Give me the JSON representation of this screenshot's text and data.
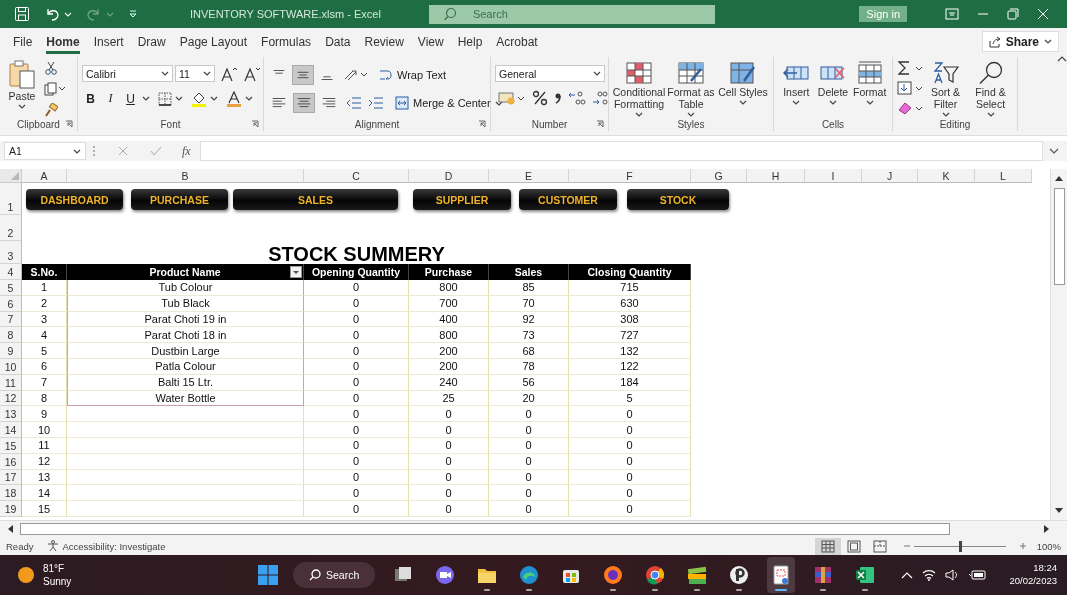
{
  "title_bar": {
    "title": "INVENTORY SOFTWARE.xlsm  -  Excel",
    "search_placeholder": "Search",
    "sign_in": "Sign in",
    "redo_disabled": true
  },
  "menu_tabs": [
    {
      "label": "File",
      "selected": false
    },
    {
      "label": "Home",
      "selected": true
    },
    {
      "label": "Insert",
      "selected": false
    },
    {
      "label": "Draw",
      "selected": false
    },
    {
      "label": "Page Layout",
      "selected": false
    },
    {
      "label": "Formulas",
      "selected": false
    },
    {
      "label": "Data",
      "selected": false
    },
    {
      "label": "Review",
      "selected": false
    },
    {
      "label": "View",
      "selected": false
    },
    {
      "label": "Help",
      "selected": false
    },
    {
      "label": "Acrobat",
      "selected": false
    }
  ],
  "share": "Share",
  "ribbon": {
    "clipboard": {
      "label": "Clipboard",
      "paste": "Paste"
    },
    "font": {
      "label": "Font",
      "font_name": "Calibri",
      "font_size": "11",
      "bold": "B",
      "italic": "I",
      "underline": "U"
    },
    "alignment": {
      "label": "Alignment",
      "vertical": [
        {
          "selected": false
        },
        {
          "selected": true
        },
        {
          "selected": false
        }
      ],
      "horizontal": [
        {
          "selected": false
        },
        {
          "selected": true
        },
        {
          "selected": false
        }
      ],
      "wrap_text": "Wrap Text",
      "merge_center": "Merge & Center"
    },
    "number": {
      "label": "Number",
      "format": "General"
    },
    "styles": {
      "label": "Styles",
      "buttons": [
        "Conditional Formatting",
        "Format as Table",
        "Cell Styles"
      ]
    },
    "cells": {
      "label": "Cells",
      "buttons": [
        "Insert",
        "Delete",
        "Format"
      ]
    },
    "editing": {
      "label": "Editing",
      "buttons": [
        "Sort & Filter",
        "Find & Select"
      ]
    }
  },
  "formula_bar": {
    "name_box": "A1",
    "fx": "fx"
  },
  "sheet": {
    "columns": [
      "A",
      "B",
      "C",
      "D",
      "E",
      "F",
      "G",
      "H",
      "I",
      "J",
      "K",
      "L"
    ],
    "nav_row": {
      "row": "1",
      "buttons": [
        "DASHBOARD",
        "PURCHASE",
        "SALES",
        "SUPPLIER",
        "CUSTOMER",
        "STOCK"
      ]
    },
    "blank_row": {
      "row": "2"
    },
    "title_row": {
      "row": "3",
      "title": "STOCK SUMMERY"
    },
    "header_row": {
      "row": "4",
      "headers": [
        "S.No.",
        "Product Name",
        "Opening Quantity",
        "Purchase",
        "Sales",
        "Closing Quantity"
      ]
    },
    "rows": [
      {
        "row": "5",
        "sno": "1",
        "product": "Tub Colour",
        "opening": "0",
        "purchase": "800",
        "sales": "85",
        "closing": "715"
      },
      {
        "row": "6",
        "sno": "2",
        "product": "Tub Black",
        "opening": "0",
        "purchase": "700",
        "sales": "70",
        "closing": "630"
      },
      {
        "row": "7",
        "sno": "3",
        "product": "Parat Choti 19 in",
        "opening": "0",
        "purchase": "400",
        "sales": "92",
        "closing": "308"
      },
      {
        "row": "8",
        "sno": "4",
        "product": "Parat Choti 18 in",
        "opening": "0",
        "purchase": "800",
        "sales": "73",
        "closing": "727"
      },
      {
        "row": "9",
        "sno": "5",
        "product": "Dustbin Large",
        "opening": "0",
        "purchase": "200",
        "sales": "68",
        "closing": "132"
      },
      {
        "row": "10",
        "sno": "6",
        "product": "Patla Colour",
        "opening": "0",
        "purchase": "200",
        "sales": "78",
        "closing": "122"
      },
      {
        "row": "11",
        "sno": "7",
        "product": "Balti 15 Ltr.",
        "opening": "0",
        "purchase": "240",
        "sales": "56",
        "closing": "184"
      },
      {
        "row": "12",
        "sno": "8",
        "product": "Water Bottle",
        "opening": "0",
        "purchase": "25",
        "sales": "20",
        "closing": "5"
      },
      {
        "row": "13",
        "sno": "9",
        "opening": "0",
        "purchase": "0",
        "sales": "0",
        "closing": "0"
      },
      {
        "row": "14",
        "sno": "10",
        "opening": "0",
        "purchase": "0",
        "sales": "0",
        "closing": "0"
      },
      {
        "row": "15",
        "sno": "11",
        "opening": "0",
        "purchase": "0",
        "sales": "0",
        "closing": "0"
      },
      {
        "row": "16",
        "sno": "12",
        "opening": "0",
        "purchase": "0",
        "sales": "0",
        "closing": "0"
      },
      {
        "row": "17",
        "sno": "13",
        "opening": "0",
        "purchase": "0",
        "sales": "0",
        "closing": "0"
      },
      {
        "row": "18",
        "sno": "14",
        "opening": "0",
        "purchase": "0",
        "sales": "0",
        "closing": "0"
      },
      {
        "row": "19",
        "sno": "15",
        "opening": "0",
        "purchase": "0",
        "sales": "0",
        "closing": "0"
      }
    ]
  },
  "status_bar": {
    "ready": "Ready",
    "accessibility": "Accessibility: Investigate",
    "views": [
      {
        "selected": true
      },
      {
        "selected": false
      },
      {
        "selected": false
      }
    ],
    "zoom": {
      "level": 0.5
    },
    "zoom_text": "100%"
  },
  "taskbar": {
    "temperature": "81°F",
    "weather": "Sunny",
    "search": "Search",
    "apps": [
      {
        "running": false,
        "active": false
      },
      {
        "running": false,
        "active": false
      },
      {
        "running": true,
        "active": false
      },
      {
        "running": true,
        "active": false
      },
      {
        "running": false,
        "active": false
      },
      {
        "running": true,
        "active": false
      },
      {
        "running": true,
        "active": false
      },
      {
        "running": true,
        "active": false
      },
      {
        "running": true,
        "active": false
      },
      {
        "running": true,
        "active": true
      },
      {
        "running": true,
        "active": false
      },
      {
        "running": true,
        "active": false
      }
    ],
    "time": "18:24",
    "date": "20/02/2023"
  }
}
